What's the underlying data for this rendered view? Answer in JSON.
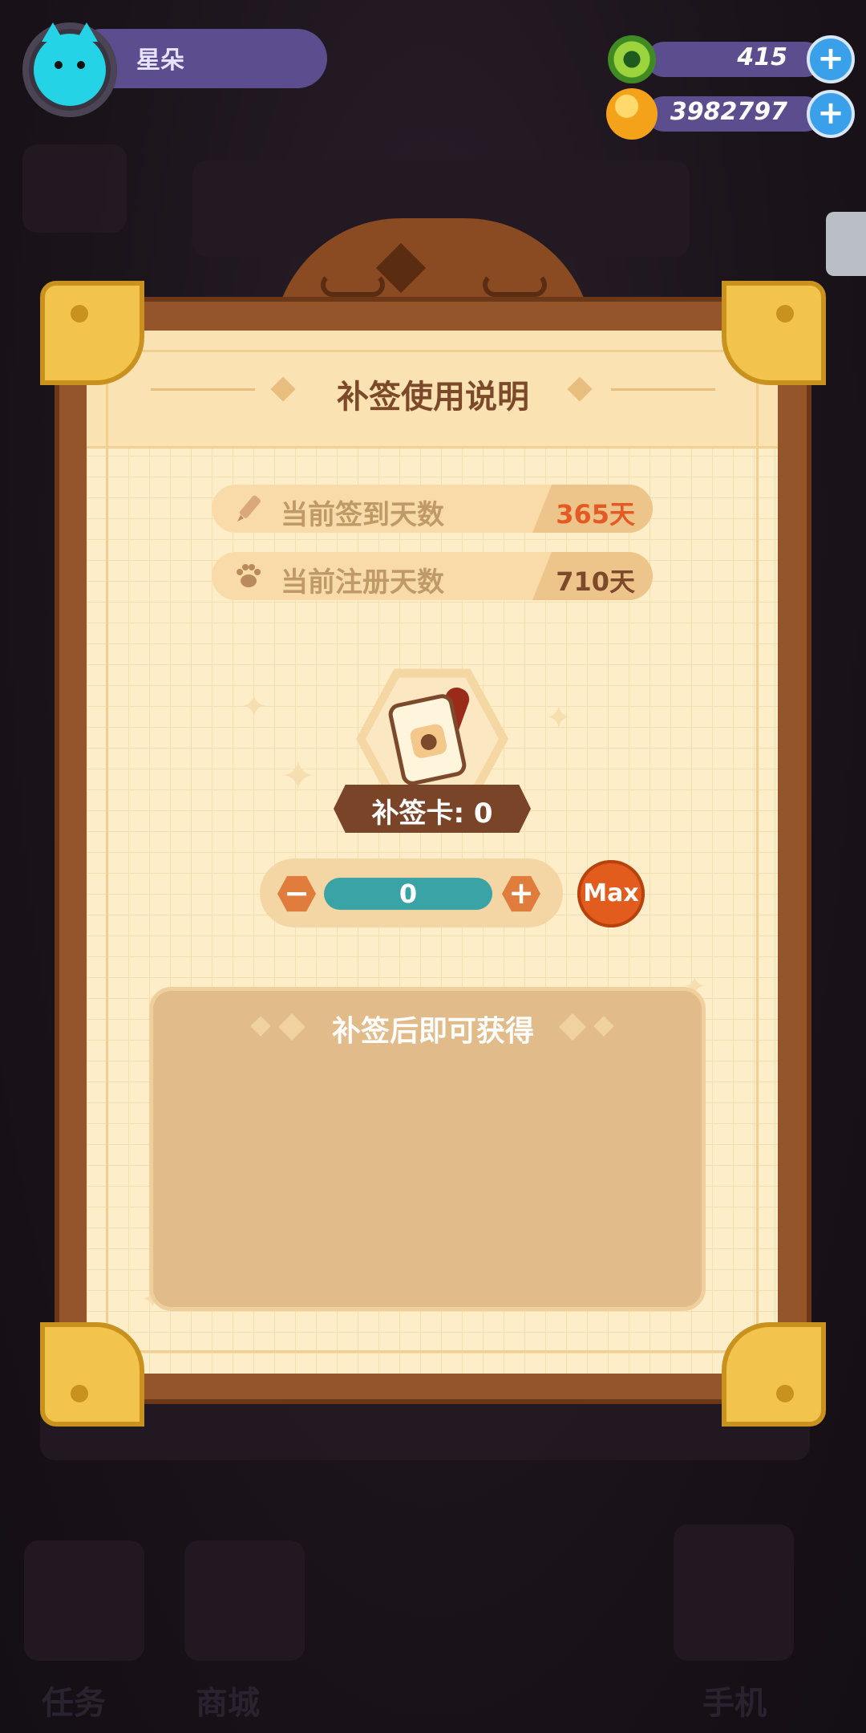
{
  "user": {
    "name": "星朵",
    "avatar_icon": "cat-avatar-icon"
  },
  "currencies": [
    {
      "icon": "green-donut-coin-icon",
      "value": "415"
    },
    {
      "icon": "planet-coin-icon",
      "value": "3982797"
    }
  ],
  "dialog": {
    "title": "补签使用说明",
    "checkin_days": {
      "label": "当前签到天数",
      "value": "365天",
      "value_color": "#e45a25",
      "icon": "pencil-icon"
    },
    "register_days": {
      "label": "当前注册天数",
      "value": "710天",
      "value_color": "#7c4a2a",
      "icon": "paw-icon"
    },
    "card": {
      "label": "补签卡: 0",
      "icon": "makeup-card-icon"
    },
    "stepper": {
      "value": "0",
      "minus": "−",
      "plus": "+"
    },
    "max_label": "Max",
    "reward_title": "补签后即可获得"
  },
  "bottom_nav": [
    "任务",
    "商城",
    "手机"
  ],
  "colors": {
    "accent": "#e25d1d",
    "frame": "#95552a",
    "paper": "#fdedc8",
    "currency_bar": "#5b4d8e"
  }
}
